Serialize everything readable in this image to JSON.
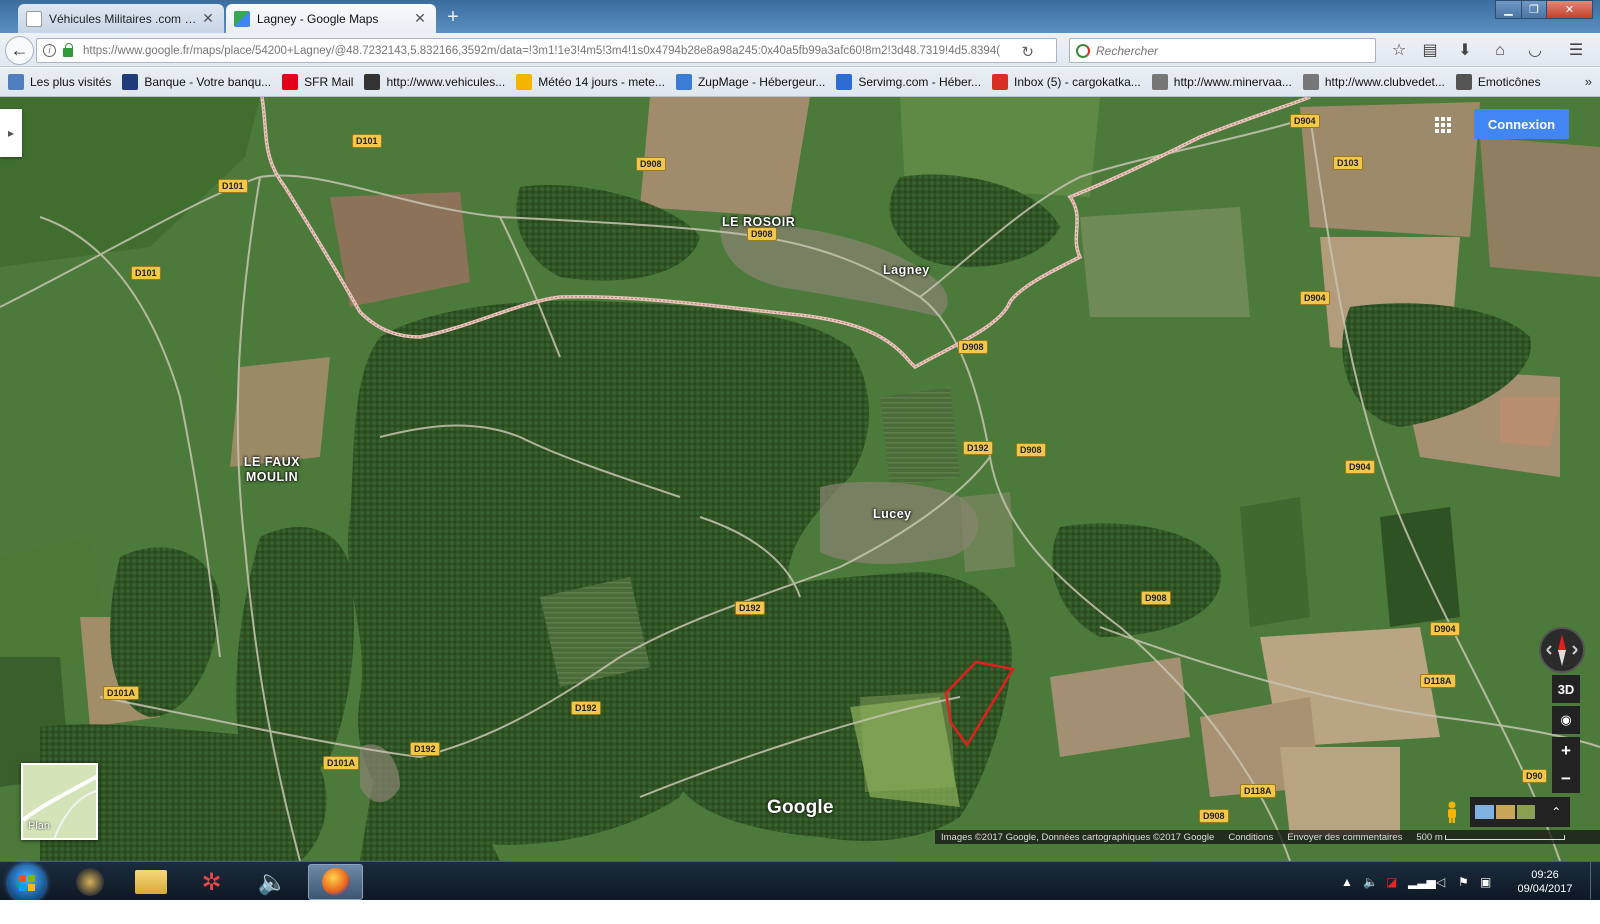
{
  "browser": {
    "tabs": [
      {
        "label": "Véhicules Militaires .com • ...",
        "favicon_color": "#333333"
      },
      {
        "label": "Lagney - Google Maps",
        "favicon_color": "#34a853"
      }
    ],
    "url": "https://www.google.fr/maps/place/54200+Lagney/@48.7232143,5.832166,3592m/data=!3m1!1e3!4m5!3m4!1s0x4794b28e8a98a245:0x40a5fb99a3afc60!8m2!3d48.7319!4d5.8394(",
    "search_placeholder": "Rechercher",
    "bookmarks": [
      {
        "label": "Les plus visités",
        "icon": "star-icon",
        "color": "#4f7fc0"
      },
      {
        "label": "Banque - Votre banqu...",
        "icon": "bank-icon",
        "color": "#1e3c78"
      },
      {
        "label": "SFR Mail",
        "icon": "sfr-icon",
        "color": "#e2001a"
      },
      {
        "label": "http://www.vehicules...",
        "icon": "soldier-icon",
        "color": "#333333"
      },
      {
        "label": "Météo 14 jours - mete...",
        "icon": "sun-icon",
        "color": "#f4b400"
      },
      {
        "label": "ZupMage - Hébergeur...",
        "icon": "t-icon",
        "color": "#3a7bd5"
      },
      {
        "label": "Servimg.com - Héber...",
        "icon": "lines-icon",
        "color": "#2b6cd6"
      },
      {
        "label": "Inbox (5) - cargokatka...",
        "icon": "gmail-icon",
        "color": "#d93025"
      },
      {
        "label": "http://www.minervaa...",
        "icon": "globe-icon",
        "color": "#777777"
      },
      {
        "label": "http://www.clubvedet...",
        "icon": "globe-icon",
        "color": "#777777"
      },
      {
        "label": "Emoticônes",
        "icon": "emoticon-icon",
        "color": "#555555"
      }
    ]
  },
  "map": {
    "connexion_label": "Connexion",
    "layer_label": "Plan",
    "logo": "Google",
    "places": [
      "LE ROSOIR",
      "Lagney",
      "LE FAUX MOULIN",
      "Lucey"
    ],
    "roads": [
      "D101",
      "D101",
      "D101",
      "D908",
      "D908",
      "D908",
      "D908",
      "D908",
      "D908",
      "D192",
      "D192",
      "D192",
      "D192",
      "D101A",
      "D101A",
      "D904",
      "D904",
      "D904",
      "D904",
      "D103",
      "D118A",
      "D118A",
      "D908",
      "D90"
    ],
    "controls": {
      "three_d": "3D",
      "zoom_in": "+",
      "zoom_out": "−"
    },
    "attribution": {
      "imagery": "Images ©2017 Google, Données cartographiques ©2017 Google",
      "terms": "Conditions",
      "feedback": "Envoyer des commentaires",
      "scale": "500 m"
    },
    "highlight_color": "#e0201e"
  },
  "taskbar": {
    "time": "09:26",
    "date": "09/04/2017"
  }
}
